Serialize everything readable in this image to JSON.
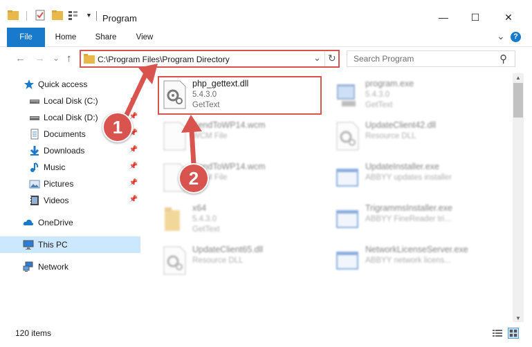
{
  "window": {
    "title": "Program",
    "minimize_glyph": "—",
    "maximize_glyph": "☐",
    "close_glyph": "✕"
  },
  "ribbon": {
    "tabs": [
      "File",
      "Home",
      "Share",
      "View"
    ],
    "expand_glyph": "⌄",
    "help_glyph": "?"
  },
  "address": {
    "path": "C:\\Program Files\\Program Directory",
    "refresh_glyph": "↻",
    "dropdown_glyph": "⌄"
  },
  "navigation": {
    "back_glyph": "←",
    "forward_glyph": "→",
    "recent_glyph": "⌄",
    "up_glyph": "↑"
  },
  "search": {
    "placeholder": "Search Program",
    "icon_glyph": "⚲"
  },
  "sidebar": {
    "items": [
      {
        "label": "Quick access",
        "icon": "star-icon",
        "pinned": false
      },
      {
        "label": "Local Disk (C:)",
        "icon": "drive-icon",
        "pinned": true
      },
      {
        "label": "Local Disk (D:)",
        "icon": "drive-icon",
        "pinned": true
      },
      {
        "label": "Documents",
        "icon": "documents-icon",
        "pinned": true
      },
      {
        "label": "Downloads",
        "icon": "downloads-icon",
        "pinned": true
      },
      {
        "label": "Music",
        "icon": "music-icon",
        "pinned": true
      },
      {
        "label": "Pictures",
        "icon": "pictures-icon",
        "pinned": true
      },
      {
        "label": "Videos",
        "icon": "videos-icon",
        "pinned": true
      },
      {
        "label": "OneDrive",
        "icon": "cloud-icon",
        "pinned": false
      },
      {
        "label": "This PC",
        "icon": "computer-icon",
        "pinned": false,
        "selected": true
      },
      {
        "label": "Network",
        "icon": "network-icon",
        "pinned": false
      }
    ],
    "pin_glyph": "📌"
  },
  "files": [
    {
      "name": "php_gettext.dll",
      "line2": "5.4.3.0",
      "line3": "GetText",
      "icon": "dll-gear-icon",
      "highlighted": true
    },
    {
      "name": "program.exe",
      "line2": "5.4.3.0",
      "line3": "GetText",
      "icon": "exe-icon"
    },
    {
      "name": "SendToWP14.wcm",
      "line2": "WCM File",
      "line3": "",
      "icon": "blank-file-icon"
    },
    {
      "name": "UpdateClient42.dll",
      "line2": "Resource DLL",
      "line3": "",
      "icon": "dll-gear-icon"
    },
    {
      "name": "SendToWP14.wcm",
      "line2": "WCM File",
      "line3": "",
      "icon": "blank-file-icon"
    },
    {
      "name": "UpdateInstaller.exe",
      "line2": "ABBYY updates installer",
      "line3": "",
      "icon": "window-app-icon"
    },
    {
      "name": "x64",
      "line2": "5.4.3.0",
      "line3": "GetText",
      "icon": "folder-icon"
    },
    {
      "name": "TrigrammsInstaller.exe",
      "line2": "ABBYY FineReader tri...",
      "line3": "",
      "icon": "window-app-icon"
    },
    {
      "name": "UpdateClient65.dll",
      "line2": "Resource DLL",
      "line3": "",
      "icon": "dll-gear-icon"
    },
    {
      "name": "NetworkLicenseServer.exe",
      "line2": "ABBYY network licens...",
      "line3": "",
      "icon": "window-app-icon"
    }
  ],
  "callouts": [
    "1",
    "2"
  ],
  "status": {
    "item_count": "120 items"
  },
  "colors": {
    "accent": "#1979ca",
    "annotation_red": "#d9534f",
    "selection": "#cce8ff"
  }
}
